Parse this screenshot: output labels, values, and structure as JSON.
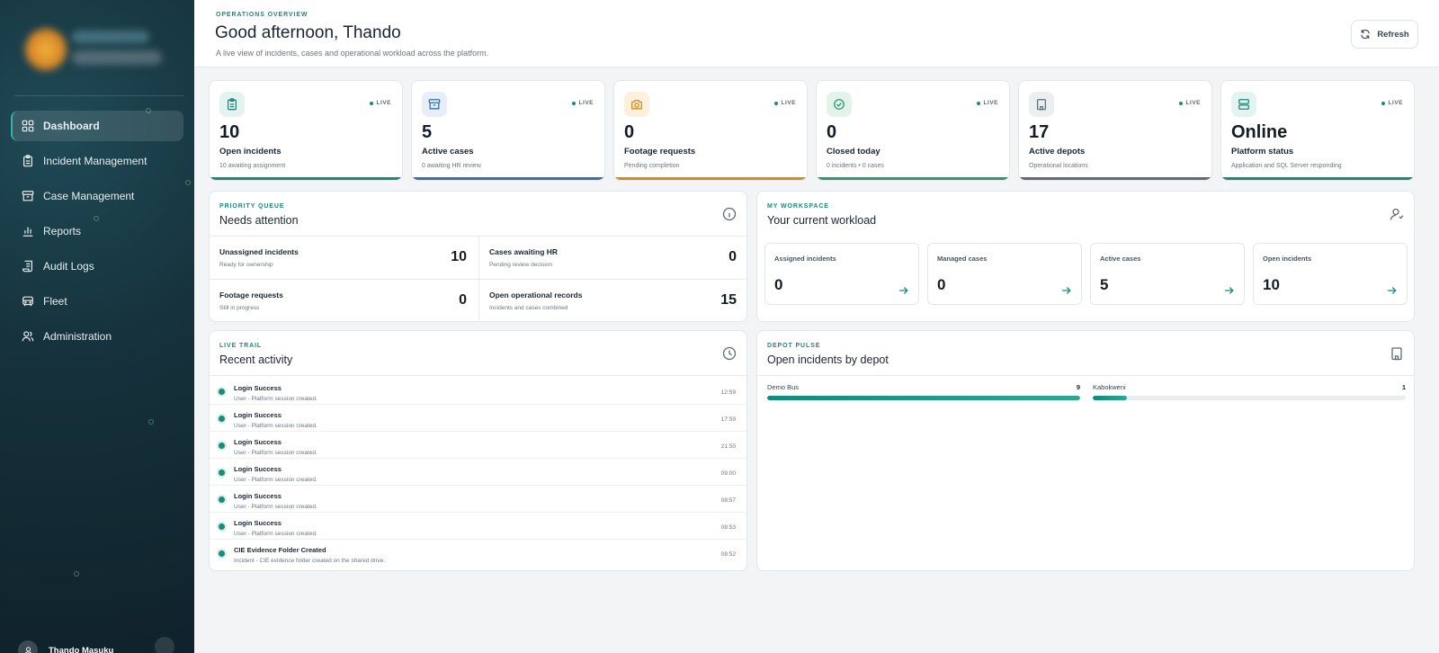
{
  "sidebar": {
    "items": [
      {
        "label": "Dashboard",
        "icon": "grid-icon",
        "active": true
      },
      {
        "label": "Incident Management",
        "icon": "clipboard-icon",
        "active": false
      },
      {
        "label": "Case Management",
        "icon": "archive-icon",
        "active": false
      },
      {
        "label": "Reports",
        "icon": "bar-chart-icon",
        "active": false
      },
      {
        "label": "Audit Logs",
        "icon": "scroll-icon",
        "active": false
      },
      {
        "label": "Fleet",
        "icon": "bus-icon",
        "active": false
      },
      {
        "label": "Administration",
        "icon": "users-icon",
        "active": false
      }
    ],
    "user": {
      "name": "Thando Masuku"
    }
  },
  "header": {
    "eyebrow": "OPERATIONS OVERVIEW",
    "greeting": "Good afternoon, Thando",
    "subtitle": "A live view of incidents, cases and operational workload across the platform.",
    "refresh_label": "Refresh"
  },
  "kpis": [
    {
      "value": "10",
      "label": "Open incidents",
      "sub": "10 awaiting assignment",
      "live": "LIVE",
      "icon": "clipboard-icon",
      "accent": "#1d8a78",
      "tint": "#e3f4f0"
    },
    {
      "value": "5",
      "label": "Active cases",
      "sub": "0 awaiting HR review",
      "live": "LIVE",
      "icon": "archive-icon",
      "accent": "#3b6fa6",
      "tint": "#e7eef7"
    },
    {
      "value": "0",
      "label": "Footage requests",
      "sub": "Pending completion",
      "live": "LIVE",
      "icon": "camera-icon",
      "accent": "#d98a1c",
      "tint": "#fdf0dc"
    },
    {
      "value": "0",
      "label": "Closed today",
      "sub": "0 incidents • 0 cases",
      "live": "LIVE",
      "icon": "check-circle-icon",
      "accent": "#2b9a6e",
      "tint": "#e2f4ea"
    },
    {
      "value": "17",
      "label": "Active depots",
      "sub": "Operational locations",
      "live": "LIVE",
      "icon": "building-icon",
      "accent": "#5f6b77",
      "tint": "#eceff2"
    },
    {
      "value": "Online",
      "label": "Platform status",
      "sub": "Application and SQL Server responding",
      "live": "LIVE",
      "icon": "server-icon",
      "accent": "#1d8a78",
      "tint": "#e3f4f0"
    }
  ],
  "priority_queue": {
    "eyebrow": "PRIORITY QUEUE",
    "title": "Needs attention",
    "items": [
      {
        "label": "Unassigned incidents",
        "sub": "Ready for ownership",
        "value": "10"
      },
      {
        "label": "Cases awaiting HR",
        "sub": "Pending review decision",
        "value": "0"
      },
      {
        "label": "Footage requests",
        "sub": "Still in progress",
        "value": "0"
      },
      {
        "label": "Open operational records",
        "sub": "Incidents and cases combined",
        "value": "15"
      }
    ]
  },
  "workspace": {
    "eyebrow": "MY WORKSPACE",
    "title": "Your current workload",
    "cards": [
      {
        "label": "Assigned incidents",
        "value": "0"
      },
      {
        "label": "Managed cases",
        "value": "0"
      },
      {
        "label": "Active cases",
        "value": "5"
      },
      {
        "label": "Open incidents",
        "value": "10"
      }
    ]
  },
  "activity": {
    "eyebrow": "LIVE TRAIL",
    "title": "Recent activity",
    "items": [
      {
        "title": "Login Success",
        "sub": "User - Platform session created.",
        "time": "12:59"
      },
      {
        "title": "Login Success",
        "sub": "User - Platform session created.",
        "time": "17:59"
      },
      {
        "title": "Login Success",
        "sub": "User - Platform session created.",
        "time": "21:50"
      },
      {
        "title": "Login Success",
        "sub": "User - Platform session created.",
        "time": "09:00"
      },
      {
        "title": "Login Success",
        "sub": "User - Platform session created.",
        "time": "08:57"
      },
      {
        "title": "Login Success",
        "sub": "User - Platform session created.",
        "time": "08:53"
      },
      {
        "title": "CIE Evidence Folder Created",
        "sub": "Incident - CIE evidence folder created on the shared drive.",
        "time": "08:52"
      }
    ]
  },
  "depot_pulse": {
    "eyebrow": "DEPOT PULSE",
    "title": "Open incidents by depot",
    "depots": [
      {
        "name": "Demo Bus",
        "count": "9",
        "fraction": 1.0
      },
      {
        "name": "Kabokweni",
        "count": "1",
        "fraction": 0.11
      }
    ]
  }
}
